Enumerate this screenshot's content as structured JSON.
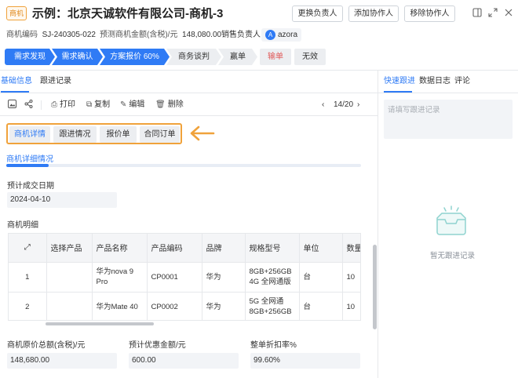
{
  "header": {
    "type_tag": "商机",
    "title": "示例：北京天诚软件有限公司-商机-3",
    "buttons": {
      "change_owner": "更换负责人",
      "add_collab": "添加协作人",
      "remove_collab": "移除协作人"
    },
    "meta": {
      "code_label": "商机编码",
      "code_value": "SJ-240305-022",
      "amount_label": "预测商机金额(含税)/元",
      "amount_value": "148,080.00",
      "owner_label": "销售负责人",
      "owner_initial": "A",
      "owner_name": "azora"
    }
  },
  "stages": {
    "s1": "需求发现",
    "s2": "需求确认",
    "s3": "方案报价 60%",
    "s4": "商务谈判",
    "s5": "赢单",
    "s6": "输单",
    "s7": "无效"
  },
  "colors": {
    "accent": "#2f7bf5",
    "highlight": "#f0a23b",
    "danger": "#e05a5a"
  },
  "main_tabs": {
    "basic": "基础信息",
    "followup": "跟进记录"
  },
  "toolbar": {
    "print": "打印",
    "copy": "复制",
    "edit": "编辑",
    "delete": "删除",
    "pager": "14/20"
  },
  "subtabs": {
    "detail": "商机详情",
    "follow": "跟进情况",
    "quote": "报价单",
    "contract": "合同订单"
  },
  "section": {
    "title": "商机详细情况",
    "close_date_label": "预计成交日期",
    "close_date_value": "2024-04-10",
    "detail_label": "商机明细"
  },
  "table": {
    "headers": {
      "select": "选择产品",
      "name": "产品名称",
      "code": "产品编码",
      "brand": "品牌",
      "spec": "规格型号",
      "unit": "单位",
      "qty": "数量"
    },
    "rows": [
      {
        "idx": "1",
        "name": "华为nova 9 Pro",
        "code": "CP0001",
        "brand": "华为",
        "spec1": "8GB+256GB",
        "spec2": "4G 全网通版",
        "unit": "台",
        "qty": "10"
      },
      {
        "idx": "2",
        "name": "华为Mate 40",
        "code": "CP0002",
        "brand": "华为",
        "spec1": "5G 全网通",
        "spec2": "8GB+256GB",
        "unit": "台",
        "qty": "10"
      }
    ]
  },
  "totals": {
    "orig_label": "商机原价总额(含税)/元",
    "orig_value": "148,680.00",
    "discount_label": "预计优惠金额/元",
    "discount_value": "600.00",
    "rate_label": "整单折扣率%",
    "rate_value": "99.60%"
  },
  "right_panel": {
    "tabs": {
      "quick": "快速跟进",
      "log": "数据日志",
      "comment": "评论"
    },
    "placeholder": "请填写跟进记录",
    "empty": "暂无跟进记录"
  }
}
